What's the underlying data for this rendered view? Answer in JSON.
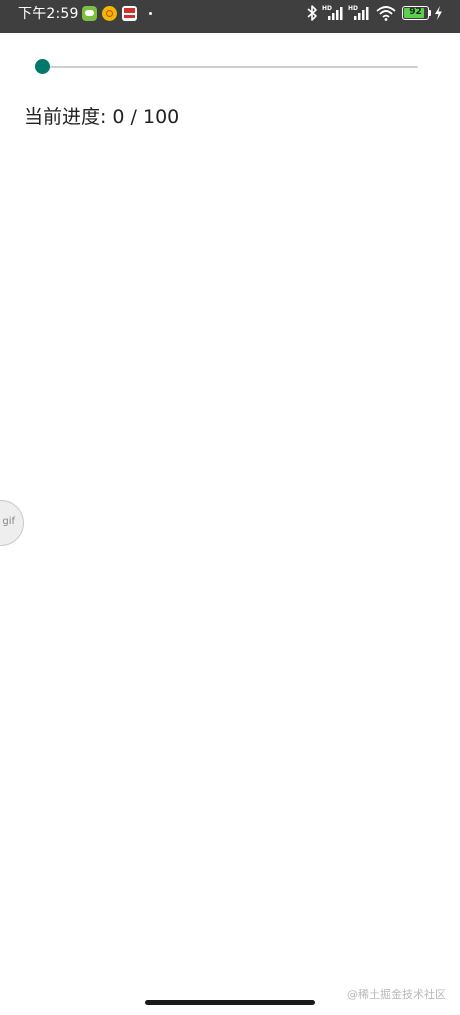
{
  "status_bar": {
    "time": "下午2:59",
    "signal_1_label": "HD",
    "signal_2_label": "HD",
    "battery_level": "92",
    "battery_fraction": 0.92,
    "notification_icons": [
      "wechat-icon",
      "app-notification-icon",
      "news-icon"
    ],
    "right_icons": [
      "bluetooth-icon",
      "signal-icon",
      "signal-icon",
      "wifi-icon",
      "battery-icon",
      "charging-icon"
    ]
  },
  "slider": {
    "value": 0,
    "max": 100,
    "accent_color": "#00796b",
    "track_color": "#cfcfcf"
  },
  "progress": {
    "label": "当前进度:",
    "value_text": "0 / 100"
  },
  "gif_badge": {
    "label": "gif"
  },
  "watermark": {
    "text": "@稀土掘金技术社区"
  }
}
